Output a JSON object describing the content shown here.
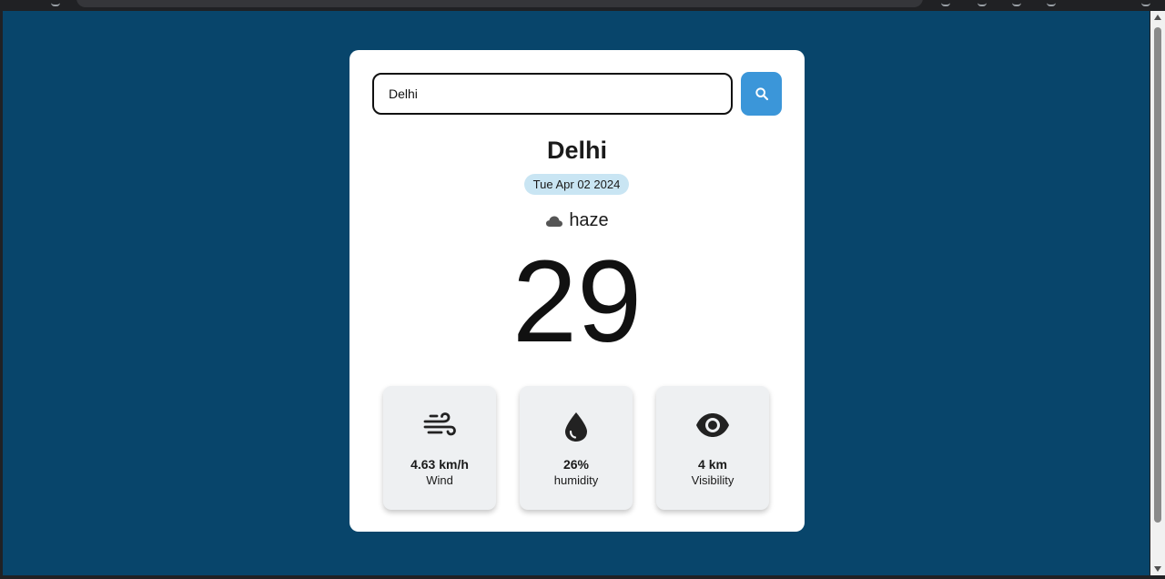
{
  "search": {
    "value": "Delhi"
  },
  "weather": {
    "city": "Delhi",
    "date": "Tue Apr 02 2024",
    "condition": "haze",
    "temperature": "29"
  },
  "stats": [
    {
      "value": "4.63 km/h",
      "label": "Wind",
      "icon": "wind-icon"
    },
    {
      "value": "26%",
      "label": "humidity",
      "icon": "water-drop-icon"
    },
    {
      "value": "4 km",
      "label": "Visibility",
      "icon": "eye-icon"
    }
  ],
  "colors": {
    "page_background": "#08456b",
    "card_background": "#ffffff",
    "search_button": "#3b96d9",
    "date_badge": "#c9e5f3",
    "stat_tile": "#eef0f2"
  }
}
